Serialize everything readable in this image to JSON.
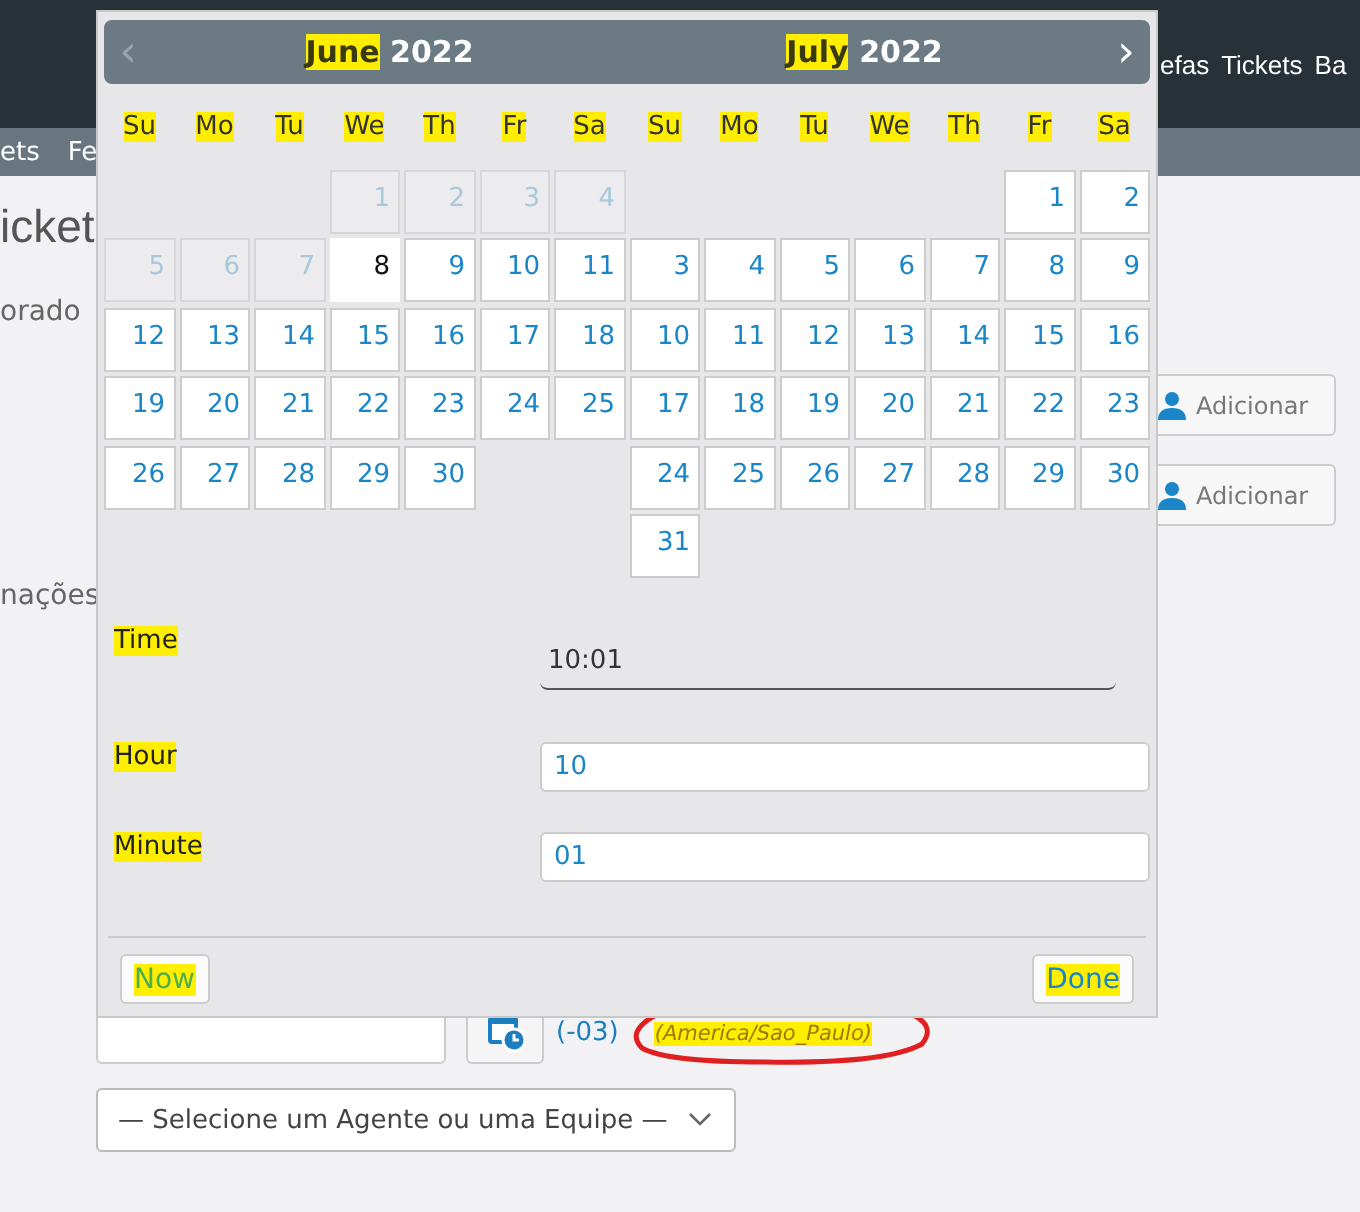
{
  "top_nav": {
    "items": [
      "efas",
      "Tickets",
      "Ba"
    ]
  },
  "sub_nav": {
    "items": [
      "ets",
      "Fe"
    ]
  },
  "page": {
    "heading": "icket",
    "texts": [
      "orado",
      "nações"
    ],
    "add_buttons": [
      "Adicionar",
      "Adicionar"
    ]
  },
  "datepicker": {
    "prev": {
      "glyph": "‹",
      "disabled": true
    },
    "next": {
      "glyph": "›",
      "disabled": false
    },
    "months": [
      {
        "name": "June",
        "year": "2022",
        "highlighted": true,
        "weekdays": [
          {
            "label": "Su",
            "highlighted": true
          },
          {
            "label": "Mo",
            "highlighted": true
          },
          {
            "label": "Tu",
            "highlighted": true
          },
          {
            "label": "We",
            "highlighted": true
          },
          {
            "label": "Th",
            "highlighted": true
          },
          {
            "label": "Fr",
            "highlighted": true
          },
          {
            "label": "Sa",
            "highlighted": true
          }
        ],
        "weeks": [
          [
            {
              "kind": "empty"
            },
            {
              "kind": "empty"
            },
            {
              "kind": "empty"
            },
            {
              "day": "1",
              "kind": "past"
            },
            {
              "day": "2",
              "kind": "past"
            },
            {
              "day": "3",
              "kind": "past"
            },
            {
              "day": "4",
              "kind": "past"
            }
          ],
          [
            {
              "day": "5",
              "kind": "past"
            },
            {
              "day": "6",
              "kind": "past"
            },
            {
              "day": "7",
              "kind": "past"
            },
            {
              "day": "8",
              "kind": "today"
            },
            {
              "day": "9",
              "kind": "normal"
            },
            {
              "day": "10",
              "kind": "normal"
            },
            {
              "day": "11",
              "kind": "normal"
            }
          ],
          [
            {
              "day": "12",
              "kind": "normal"
            },
            {
              "day": "13",
              "kind": "normal"
            },
            {
              "day": "14",
              "kind": "normal"
            },
            {
              "day": "15",
              "kind": "normal"
            },
            {
              "day": "16",
              "kind": "normal"
            },
            {
              "day": "17",
              "kind": "normal"
            },
            {
              "day": "18",
              "kind": "normal"
            }
          ],
          [
            {
              "day": "19",
              "kind": "normal"
            },
            {
              "day": "20",
              "kind": "normal"
            },
            {
              "day": "21",
              "kind": "normal"
            },
            {
              "day": "22",
              "kind": "normal"
            },
            {
              "day": "23",
              "kind": "normal"
            },
            {
              "day": "24",
              "kind": "normal"
            },
            {
              "day": "25",
              "kind": "normal"
            }
          ],
          [
            {
              "day": "26",
              "kind": "normal"
            },
            {
              "day": "27",
              "kind": "normal"
            },
            {
              "day": "28",
              "kind": "normal"
            },
            {
              "day": "29",
              "kind": "normal"
            },
            {
              "day": "30",
              "kind": "normal"
            },
            {
              "kind": "empty"
            },
            {
              "kind": "empty"
            }
          ]
        ]
      },
      {
        "name": "July",
        "year": "2022",
        "highlighted": true,
        "weekdays": [
          {
            "label": "Su",
            "highlighted": true
          },
          {
            "label": "Mo",
            "highlighted": true
          },
          {
            "label": "Tu",
            "highlighted": true
          },
          {
            "label": "We",
            "highlighted": true
          },
          {
            "label": "Th",
            "highlighted": true
          },
          {
            "label": "Fr",
            "highlighted": true
          },
          {
            "label": "Sa",
            "highlighted": true
          }
        ],
        "weeks": [
          [
            {
              "kind": "empty"
            },
            {
              "kind": "empty"
            },
            {
              "kind": "empty"
            },
            {
              "kind": "empty"
            },
            {
              "kind": "empty"
            },
            {
              "day": "1",
              "kind": "normal"
            },
            {
              "day": "2",
              "kind": "normal"
            }
          ],
          [
            {
              "day": "3",
              "kind": "normal"
            },
            {
              "day": "4",
              "kind": "normal"
            },
            {
              "day": "5",
              "kind": "normal"
            },
            {
              "day": "6",
              "kind": "normal"
            },
            {
              "day": "7",
              "kind": "normal"
            },
            {
              "day": "8",
              "kind": "normal"
            },
            {
              "day": "9",
              "kind": "normal"
            }
          ],
          [
            {
              "day": "10",
              "kind": "normal"
            },
            {
              "day": "11",
              "kind": "normal"
            },
            {
              "day": "12",
              "kind": "normal"
            },
            {
              "day": "13",
              "kind": "normal"
            },
            {
              "day": "14",
              "kind": "normal"
            },
            {
              "day": "15",
              "kind": "normal"
            },
            {
              "day": "16",
              "kind": "normal"
            }
          ],
          [
            {
              "day": "17",
              "kind": "normal"
            },
            {
              "day": "18",
              "kind": "normal"
            },
            {
              "day": "19",
              "kind": "normal"
            },
            {
              "day": "20",
              "kind": "normal"
            },
            {
              "day": "21",
              "kind": "normal"
            },
            {
              "day": "22",
              "kind": "normal"
            },
            {
              "day": "23",
              "kind": "normal"
            }
          ],
          [
            {
              "day": "24",
              "kind": "normal"
            },
            {
              "day": "25",
              "kind": "normal"
            },
            {
              "day": "26",
              "kind": "normal"
            },
            {
              "day": "27",
              "kind": "normal"
            },
            {
              "day": "28",
              "kind": "normal"
            },
            {
              "day": "29",
              "kind": "normal"
            },
            {
              "day": "30",
              "kind": "normal"
            }
          ],
          [
            {
              "day": "31",
              "kind": "normal"
            }
          ]
        ]
      }
    ],
    "time": {
      "label": "Time",
      "highlighted": true,
      "value": "10:01"
    },
    "fields": [
      {
        "label": "Hour",
        "highlighted": true,
        "value": "10"
      },
      {
        "label": "Minute",
        "highlighted": true,
        "value": "01"
      }
    ],
    "buttons": [
      {
        "label": "Now",
        "kind": "now",
        "highlighted": true
      },
      {
        "label": "Done",
        "kind": "done",
        "highlighted": true
      }
    ]
  },
  "date_row": {
    "offset": "(-03)",
    "timezone": {
      "text": "(America/Sao_Paulo)",
      "highlighted": true,
      "circled": true
    }
  },
  "assignee_select": {
    "value": "— Selecione um Agente ou uma Equipe —"
  }
}
